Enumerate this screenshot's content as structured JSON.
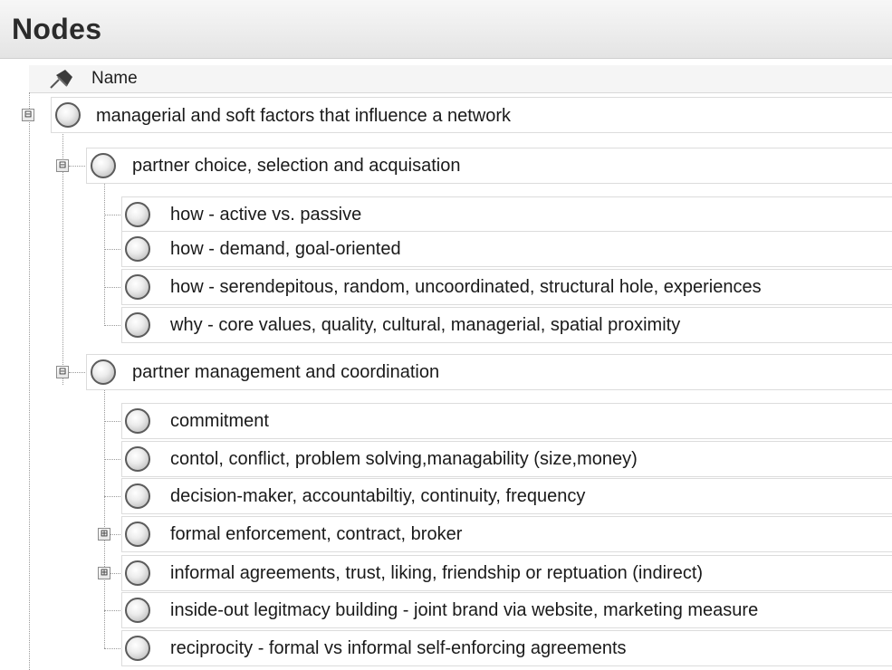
{
  "panel": {
    "title": "Nodes"
  },
  "columns": {
    "name": "Name"
  },
  "tree": {
    "root": {
      "label": "managerial and soft factors that influence a network",
      "expander": "⊟",
      "children": [
        {
          "label": "partner choice, selection and acquisation",
          "expander": "⊟",
          "children": [
            {
              "label": "how - active vs. passive"
            },
            {
              "label": "how - demand, goal-oriented"
            },
            {
              "label": "how - serendepitous, random, uncoordinated, structural hole, experiences"
            },
            {
              "label": "why - core values, quality, cultural, managerial, spatial proximity"
            }
          ]
        },
        {
          "label": "partner management and coordination",
          "expander": "⊟",
          "children": [
            {
              "label": "commitment"
            },
            {
              "label": "contol, conflict, problem solving,managability (size,money)"
            },
            {
              "label": "decision-maker, accountabiltiy, continuity, frequency"
            },
            {
              "label": "formal enforcement, contract, broker",
              "expander": "⊞"
            },
            {
              "label": "informal agreements, trust, liking, friendship or reptuation (indirect)",
              "expander": "⊞"
            },
            {
              "label": "inside-out legitmacy building - joint brand via website, marketing measure"
            },
            {
              "label": "reciprocity - formal vs informal self-enforcing agreements"
            }
          ]
        }
      ]
    }
  }
}
